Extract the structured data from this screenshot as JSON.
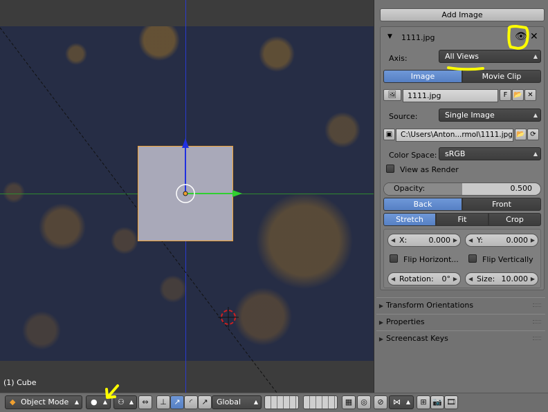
{
  "viewport": {
    "object_label": "(1) Cube"
  },
  "panel": {
    "add_image_label": "Add Image",
    "image_entry": {
      "name": "1111.jpg",
      "axis_label": "Axis:",
      "axis_value": "All Views",
      "tab_image": "Image",
      "tab_movie_clip": "Movie Clip",
      "datablock_name": "1111.jpg",
      "fake_user": "F",
      "source_label": "Source:",
      "source_value": "Single Image",
      "filepath": "C:\\Users\\Anton...rmol\\1111.jpg",
      "color_space_label": "Color Space:",
      "color_space_value": "sRGB",
      "view_as_render": "View as Render",
      "opacity_label": "Opacity:",
      "opacity_value": "0.500",
      "opacity_fraction": 0.5,
      "depth_back": "Back",
      "depth_front": "Front",
      "frame_stretch": "Stretch",
      "frame_fit": "Fit",
      "frame_crop": "Crop",
      "x_label": "X:",
      "x_value": "0.000",
      "y_label": "Y:",
      "y_value": "0.000",
      "flip_h": "Flip Horizont...",
      "flip_v": "Flip Vertically",
      "rotation_label": "Rotation:",
      "rotation_value": "0°",
      "size_label": "Size:",
      "size_value": "10.000"
    },
    "sections": [
      {
        "label": "Transform Orientations"
      },
      {
        "label": "Properties"
      },
      {
        "label": "Screencast Keys"
      }
    ]
  },
  "footer": {
    "mode_label": "Object Mode",
    "orientation_label": "Global"
  },
  "colors": {
    "accent_blue": "#5680c4",
    "annotation_yellow": "#ffff00",
    "cube_outline": "#f0a030"
  }
}
